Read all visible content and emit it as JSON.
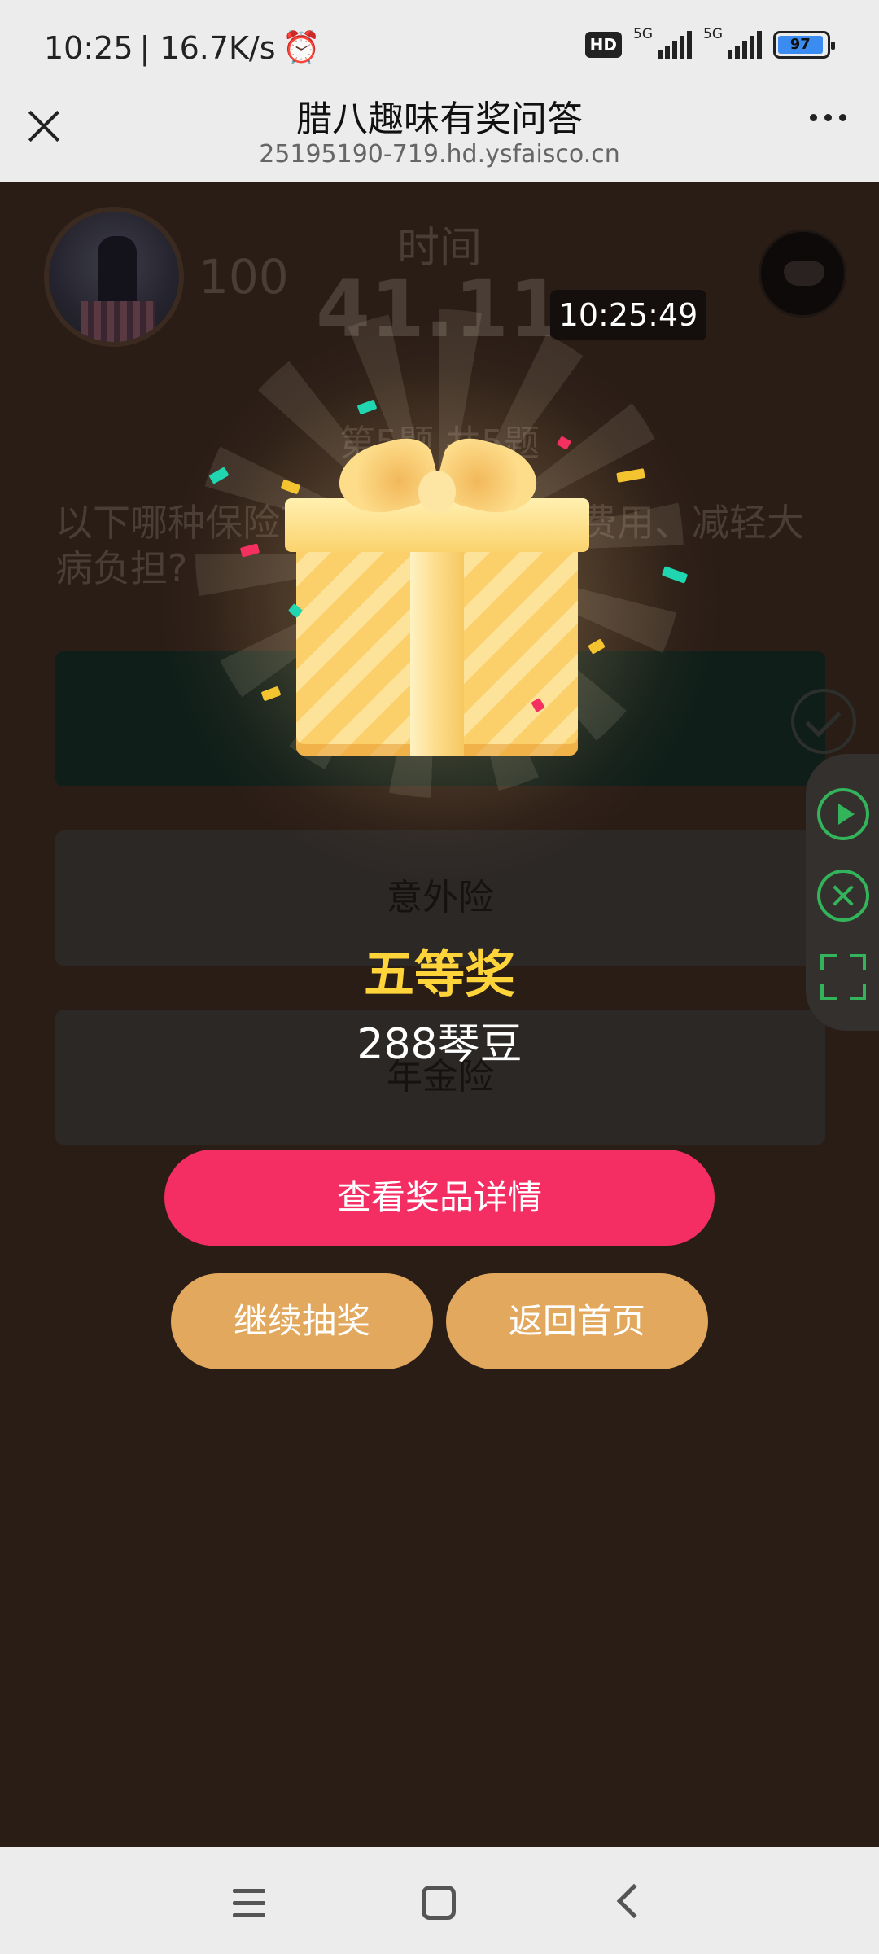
{
  "status_bar": {
    "time": "10:25",
    "speed": "| 16.7K/s",
    "hd": "HD",
    "network1": "5G",
    "network2": "5G",
    "battery": "97"
  },
  "browser": {
    "title": "腊八趣味有奖问答",
    "url": "25195190-719.hd.ysfaisco.cn"
  },
  "quiz": {
    "score": "100",
    "time_label": "时间",
    "time_value": "41.11",
    "clock_badge": "10:25:49",
    "question_number": "第5题 共5题",
    "question_text": "以下哪种保险可以帮助支付医疗费用、减轻大病负担?",
    "answers": [
      {
        "label": ""
      },
      {
        "label": "意外险"
      },
      {
        "label": "年金险"
      }
    ]
  },
  "prize": {
    "level": "五等奖",
    "name": "288琴豆",
    "detail_button": "查看奖品详情",
    "continue_button": "继续抽奖",
    "home_button": "返回首页"
  },
  "colors": {
    "prize_level": "#ffd43a",
    "detail_button": "#f42d63",
    "secondary_button": "#e2a85e",
    "tool_accent": "#33b35a"
  }
}
